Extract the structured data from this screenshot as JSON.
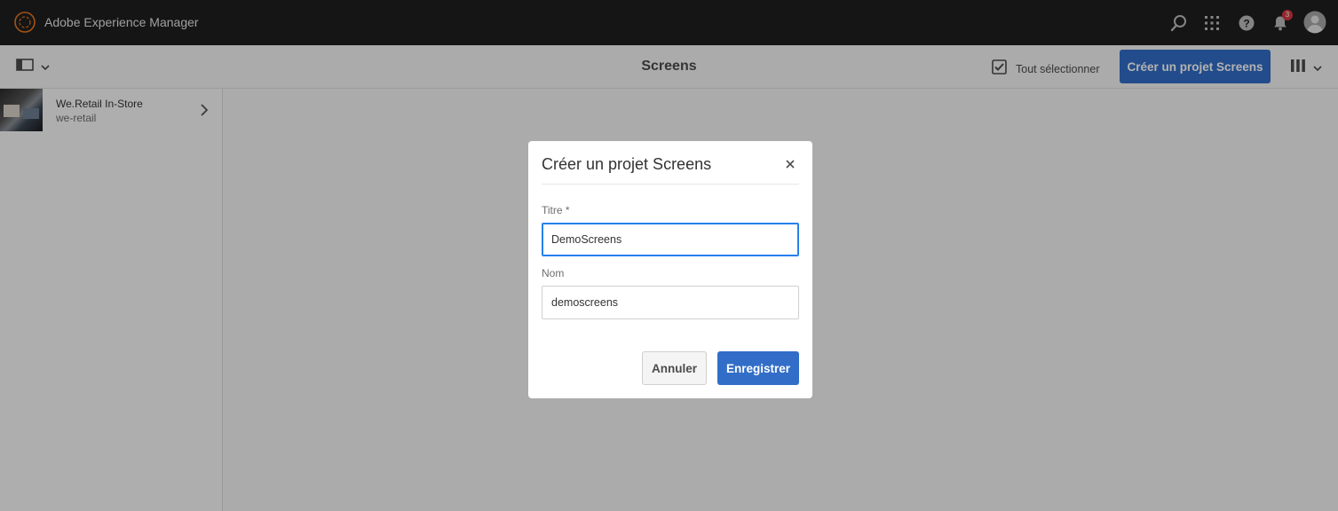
{
  "shell": {
    "app_name": "Adobe Experience Manager",
    "icons": [
      "search-icon",
      "apps-grid-icon",
      "help-icon",
      "bell-icon",
      "user-avatar"
    ],
    "notification_count": "3"
  },
  "actionbar": {
    "title": "Screens",
    "select_all_label": "Tout sélectionner",
    "create_button_label": "Créer un projet Screens"
  },
  "column": {
    "items": [
      {
        "title": "We.Retail In-Store",
        "subtitle": "we-retail"
      }
    ]
  },
  "dialog": {
    "title": "Créer un projet Screens",
    "fields": [
      {
        "label": "Titre *",
        "value": "DemoScreens"
      },
      {
        "label": "Nom",
        "value": "demoscreens"
      }
    ],
    "cancel_label": "Annuler",
    "save_label": "Enregistrer"
  },
  "colors": {
    "shell_bg": "#1f1f1f",
    "accent": "#326ec8",
    "focus": "#2680eb",
    "badge": "#d7373f"
  }
}
